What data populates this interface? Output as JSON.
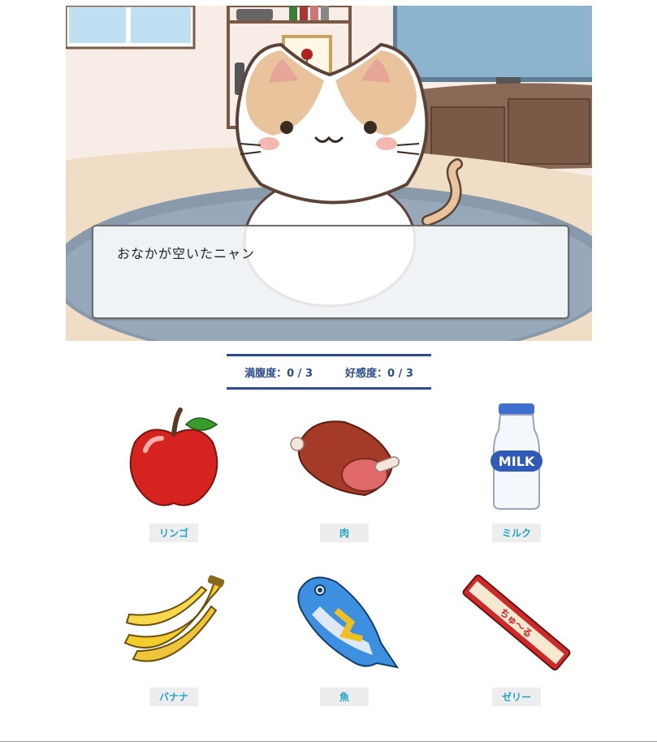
{
  "dialog": {
    "text": "おなかが空いたニャン"
  },
  "stats": {
    "fullness_label": "満腹度：",
    "fullness_value": "0 / 3",
    "affection_label": "好感度：",
    "affection_value": "0 / 3"
  },
  "items": [
    {
      "label": "リンゴ",
      "icon": "apple-icon"
    },
    {
      "label": "肉",
      "icon": "meat-icon"
    },
    {
      "label": "ミルク",
      "icon": "milk-icon"
    },
    {
      "label": "バナナ",
      "icon": "banana-icon"
    },
    {
      "label": "魚",
      "icon": "fish-icon"
    },
    {
      "label": "ゼリー",
      "icon": "jelly-icon"
    }
  ],
  "milk_bottle_text": "MILK",
  "jelly_wrapper_text": "ちゅ〜る",
  "colors": {
    "accent": "#2b4d8e",
    "label_text": "#1fa5c9",
    "label_bg": "#ededed"
  }
}
